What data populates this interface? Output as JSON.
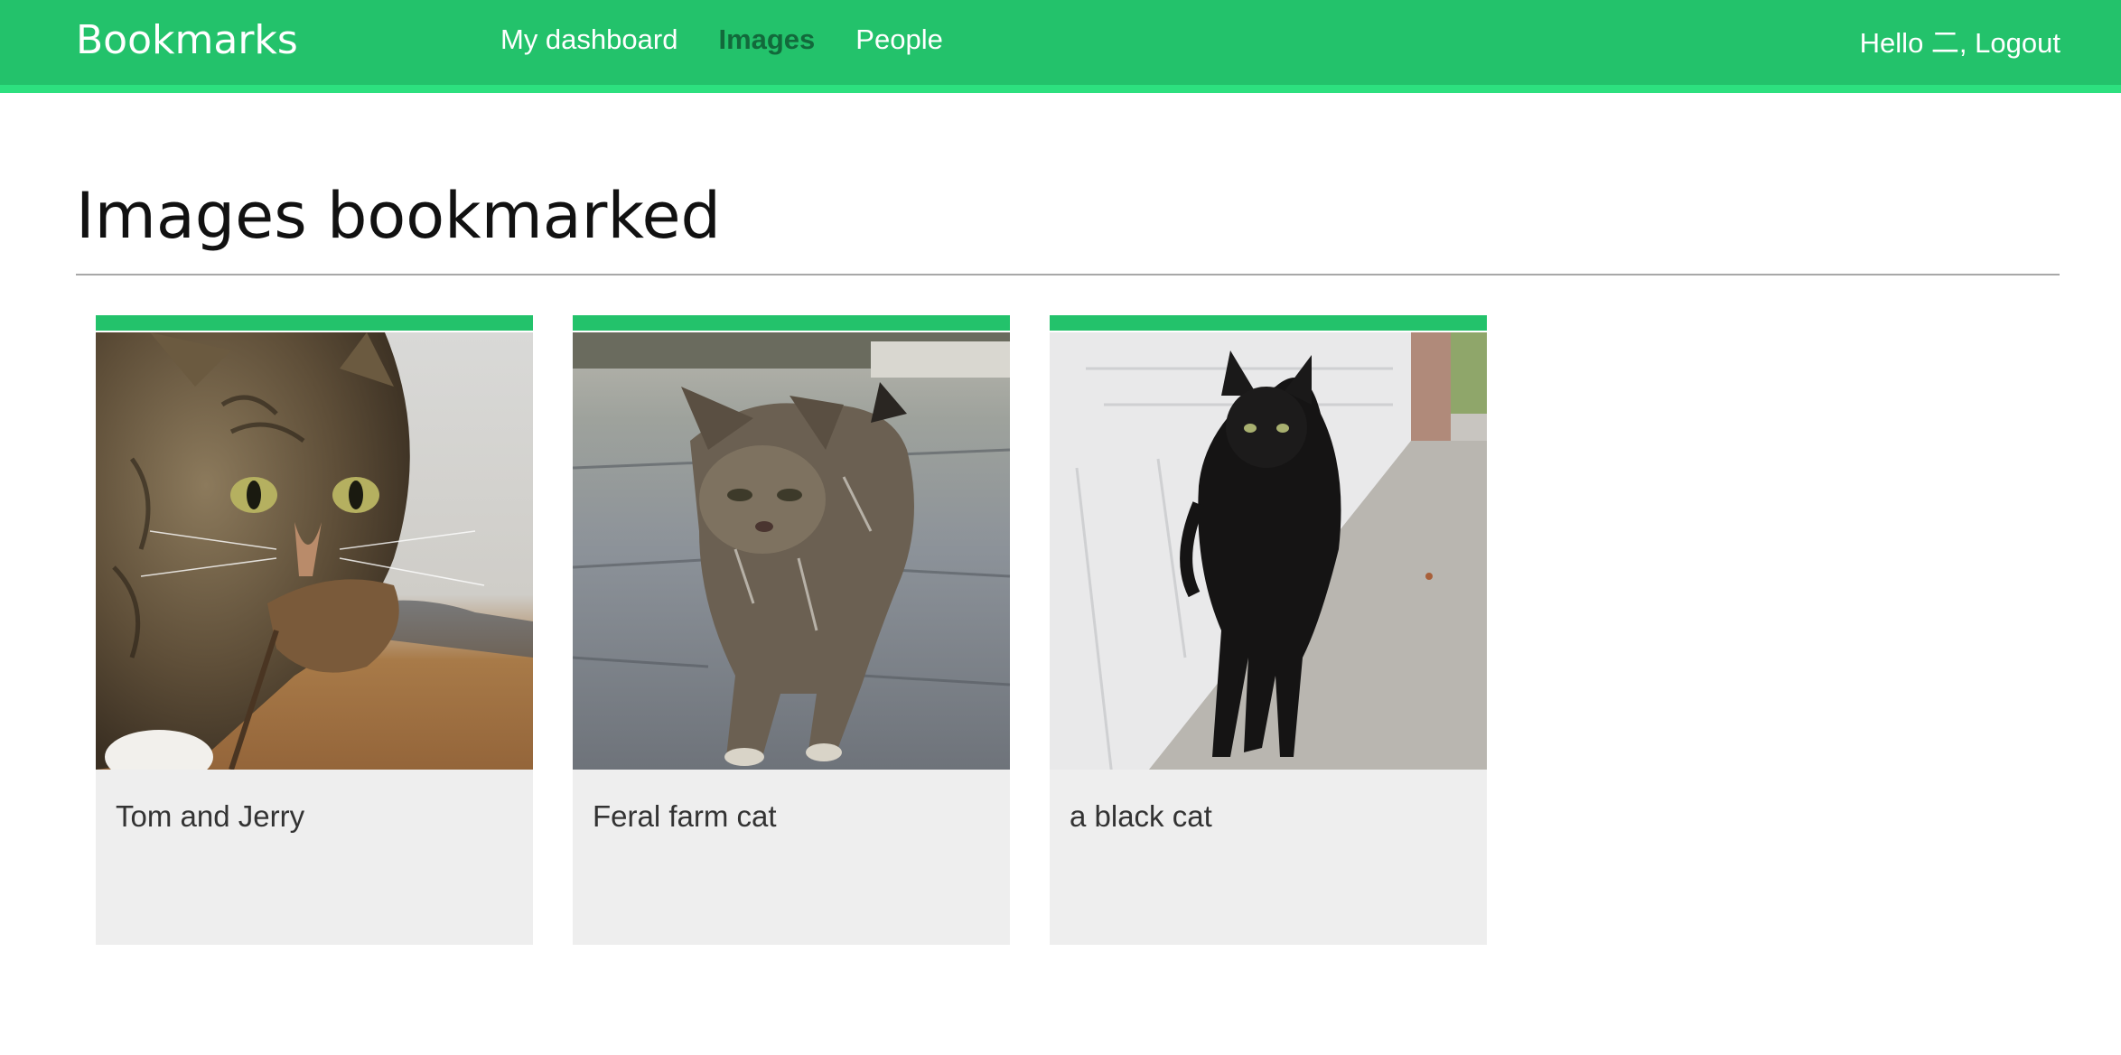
{
  "header": {
    "logo": "Bookmarks",
    "menu": [
      {
        "label": "My dashboard",
        "selected": false
      },
      {
        "label": "Images",
        "selected": true
      },
      {
        "label": "People",
        "selected": false
      }
    ],
    "user": {
      "greeting": "Hello 二,",
      "logout_label": "Logout"
    }
  },
  "colors": {
    "brand": "#23c26b",
    "brand_light": "#2de07f",
    "active_menu": "#12693b",
    "card_bg": "#eeeeee"
  },
  "main": {
    "title": "Images bookmarked",
    "images": [
      {
        "title": "Tom and Jerry",
        "image": "tabby-cat-holding-mouse-photo"
      },
      {
        "title": "Feral farm cat",
        "image": "feral-tabby-cat-walking-photo"
      },
      {
        "title": "a black cat",
        "image": "black-cat-walking-photo"
      }
    ]
  }
}
